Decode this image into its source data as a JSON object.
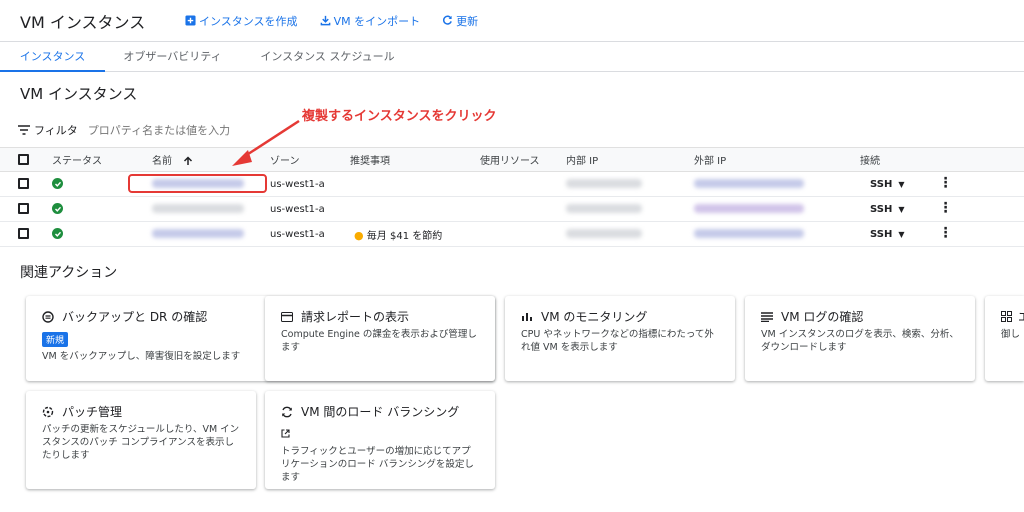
{
  "header": {
    "title": "VM インスタンス",
    "create_label": "インスタンスを作成",
    "import_label": "VM をインポート",
    "refresh_label": "更新"
  },
  "tabs": [
    {
      "label": "インスタンス",
      "active": true
    },
    {
      "label": "オブザーバビリティ",
      "active": false
    },
    {
      "label": "インスタンス スケジュール",
      "active": false
    }
  ],
  "section_title": "VM インスタンス",
  "filter": {
    "label": "フィルタ",
    "placeholder": "プロパティ名または値を入力"
  },
  "table": {
    "columns": [
      "ステータス",
      "名前",
      "ゾーン",
      "推奨事項",
      "使用リソース",
      "内部 IP",
      "外部 IP",
      "接続"
    ],
    "rows": [
      {
        "zone": "us-west1-a",
        "recommendation": "",
        "connect": "SSH"
      },
      {
        "zone": "us-west1-a",
        "recommendation": "",
        "connect": "SSH"
      },
      {
        "zone": "us-west1-a",
        "recommendation": "毎月 $41 を節約",
        "connect": "SSH"
      }
    ]
  },
  "annotation": "複製するインスタンスをクリック",
  "related": {
    "title": "関連アクション",
    "cards": [
      {
        "title": "バックアップと DR の確認",
        "badge": "新規",
        "desc": "VM をバックアップし、障害復旧を設定します",
        "icon": "backup-icon"
      },
      {
        "title": "請求レポートの表示",
        "desc": "Compute Engine の課金を表示および管理します",
        "icon": "billing-icon"
      },
      {
        "title": "VM のモニタリング",
        "desc": "CPU やネットワークなどの指標にわたって外れ値 VM を表示します",
        "icon": "chart-icon"
      },
      {
        "title": "VM ログの確認",
        "desc": "VM インスタンスのログを表示、検索、分析、ダウンロードします",
        "icon": "logs-icon"
      },
      {
        "title": "エ",
        "desc": "御し",
        "icon": "grid-icon"
      },
      {
        "title": "パッチ管理",
        "desc": "パッチの更新をスケジュールしたり、VM インスタンスのパッチ コンプライアンスを表示したりします",
        "icon": "patch-icon"
      },
      {
        "title": "VM 間のロード バランシング",
        "desc": "トラフィックとユーザーの増加に応じてアプリケーションのロード バランシングを設定します",
        "icon": "loadbalance-icon"
      }
    ]
  },
  "colors": {
    "accent": "#1a73e8",
    "status_ok": "#1e8e3e",
    "annotation": "#e53935"
  }
}
